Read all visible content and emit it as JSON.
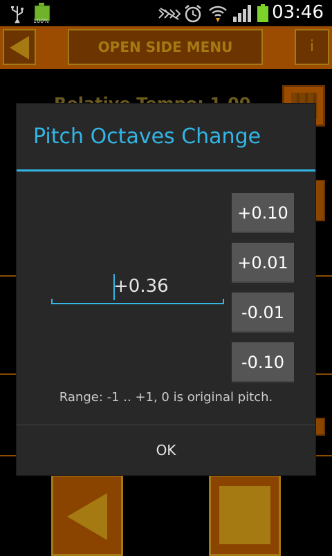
{
  "status_bar": {
    "time": "03:46",
    "battery_small_percent": "100%",
    "icons": [
      "usb-icon",
      "battery-icon",
      "mute-icon",
      "alarm-icon",
      "wifi-icon",
      "signal-icon",
      "battery-icon"
    ]
  },
  "background_app": {
    "menu_button_label": "OPEN SIDE MENU",
    "info_button_label": "i",
    "tempo_label": "Relative Tempo: 1.00"
  },
  "dialog": {
    "title": "Pitch Octaves Change",
    "value": "+0.36",
    "buttons": [
      "+0.10",
      "+0.01",
      "-0.01",
      "-0.10"
    ],
    "range_text": "Range: -1 .. +1, 0 is original pitch.",
    "ok_label": "OK"
  },
  "colors": {
    "accent": "#33b5e5",
    "app_orange": "#9b4c00",
    "app_gold": "#a57a12",
    "dialog_bg": "#282828"
  }
}
